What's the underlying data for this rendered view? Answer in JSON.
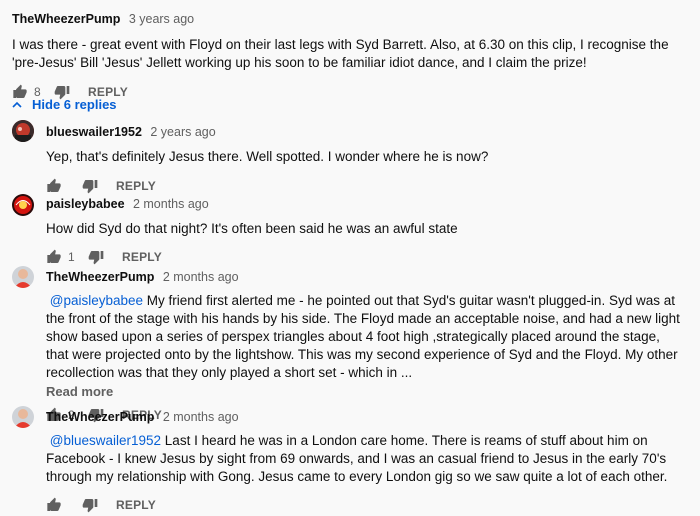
{
  "top_comment": {
    "author": "TheWheezerPump",
    "time": "3 years ago",
    "text": "I was there - great event with Floyd on their last legs with Syd Barrett. Also, at 6.30 on this clip, I recognise the 'pre-Jesus' Bill 'Jesus' Jellett working up his soon to be familiar idiot dance, and I claim the prize!",
    "likes": "8",
    "reply_label": "REPLY"
  },
  "replies_toggle": {
    "label": "Hide 6 replies"
  },
  "replies": [
    {
      "author": "blueswailer1952",
      "time": "2 years ago",
      "text": "Yep, that's definitely Jesus there. Well spotted. I wonder where he is now?",
      "likes": "",
      "reply_label": "REPLY"
    },
    {
      "author": "paisleybabee",
      "time": "2 months ago",
      "text": "How did Syd do that night? It's often been said he was an awful state",
      "likes": "1",
      "reply_label": "REPLY"
    },
    {
      "author": "TheWheezerPump",
      "time": "2 months ago",
      "mention": "@paisleybabee",
      "text": " My friend first alerted me - he pointed out that Syd's guitar wasn't plugged-in. Syd was at the front of the stage with his hands by his side. The Floyd made an acceptable noise, and had a new light show based upon a series of perspex triangles about 4 foot high ,strategically placed around the stage, that were projected onto by the lightshow. This was my second experience of Syd and the Floyd. My other recollection was that they only played a short set - which in ...",
      "read_more": "Read more",
      "likes": "2",
      "reply_label": "REPLY"
    },
    {
      "author": "TheWheezerPump",
      "time": "2 months ago",
      "mention": "@blueswailer1952",
      "text": " Last I heard he was in a London care home. There is reams of stuff about him on Facebook - I knew Jesus by sight from 69 onwards, and I was an casual friend to Jesus in the early 70's through my relationship with Gong. Jesus came to every London gig so we saw quite a lot of each other.",
      "likes": "",
      "reply_label": "REPLY"
    }
  ],
  "colors": {
    "link": "#065fd4",
    "muted": "#606060",
    "text": "#0f0f0f"
  }
}
